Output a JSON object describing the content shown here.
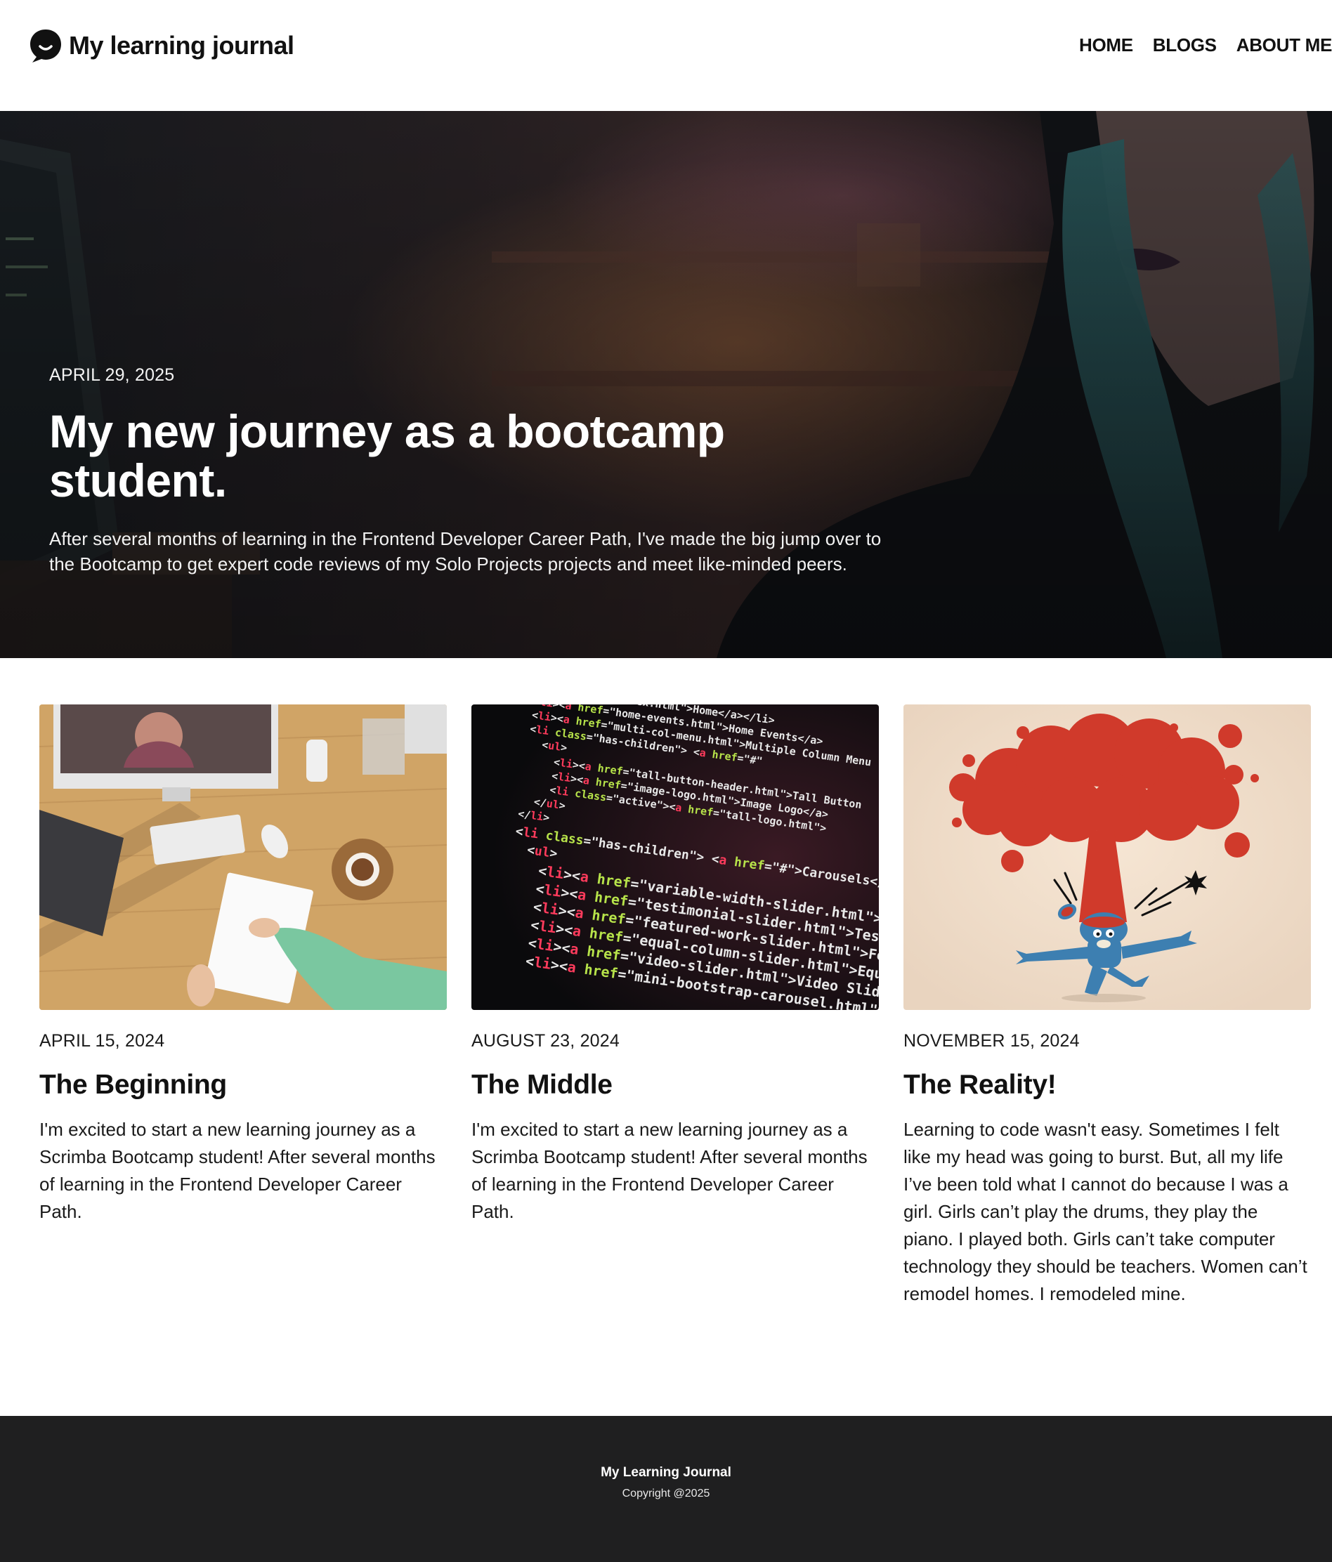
{
  "header": {
    "brand_title": "My learning journal",
    "brand_icon": "speech-bubble-smile-icon",
    "nav": [
      {
        "label": "HOME"
      },
      {
        "label": "BLOGS"
      },
      {
        "label": "ABOUT ME"
      }
    ]
  },
  "hero": {
    "date": "APRIL 29, 2025",
    "title": "My new journey as a bootcamp student.",
    "description": "After several months of learning in the Frontend Developer Career Path, I've made the big jump over to the Bootcamp to get expert code reviews of my Solo Projects projects and meet like-minded peers."
  },
  "posts": [
    {
      "date": "APRIL 15, 2024",
      "title": "The Beginning",
      "body": "I'm excited to start a new learning journey as a Scrimba Bootcamp student! After several months of learning in the Frontend Developer Career Path."
    },
    {
      "date": "AUGUST 23, 2024",
      "title": "The Middle",
      "body": "I'm excited to start a new learning journey as a Scrimba Bootcamp student! After several months of learning in the Frontend Developer Career Path."
    },
    {
      "date": "NOVEMBER 15, 2024",
      "title": "The Reality!",
      "body": "Learning to code wasn't easy. Sometimes I felt like my head was going to burst. But, all my life I’ve been told what I cannot do because I was a girl. Girls can’t play the drums, they play the piano. I played both. Girls can’t take computer technology they should be teachers. Women can’t remodel homes. I remodeled mine."
    }
  ],
  "footer": {
    "title": "My Learning Journal",
    "copyright": "Copyright @2025"
  },
  "colors": {
    "footer_bg": "#1f1f20",
    "text": "#111111",
    "explosion_red": "#d03a2b",
    "figure_blue": "#3d7fb1"
  }
}
